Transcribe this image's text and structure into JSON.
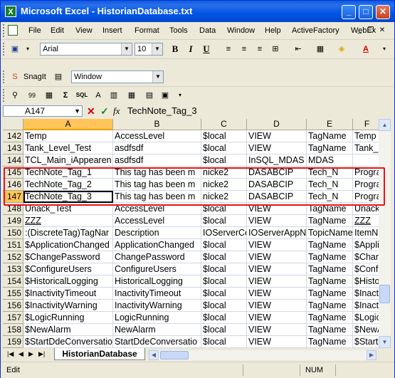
{
  "window": {
    "title": "Microsoft Excel - HistorianDatabase.txt"
  },
  "menu": [
    "File",
    "Edit",
    "View",
    "Insert",
    "Format",
    "Tools",
    "Data",
    "Window",
    "Help",
    "ActiveFactory",
    "WebEx"
  ],
  "formatting": {
    "font": "Arial",
    "size": "10",
    "bold": "B",
    "italic": "I",
    "underline": "U"
  },
  "snagit": {
    "label": "SnagIt",
    "capture_mode": "Window"
  },
  "formula_bar": {
    "cell_ref": "A147",
    "fx": "fx",
    "content": "TechNote_Tag_3"
  },
  "grid": {
    "columns": [
      "A",
      "B",
      "C",
      "D",
      "E",
      "F"
    ],
    "selected_column": "A",
    "selected_row": "147",
    "rows": [
      {
        "n": "142",
        "cells": [
          "Temp",
          "AccessLevel",
          "$local",
          "VIEW",
          "TagName",
          "Temp"
        ]
      },
      {
        "n": "143",
        "cells": [
          "Tank_Level_Test",
          "asdfsdf",
          "$local",
          "VIEW",
          "TagName",
          "Tank_L"
        ]
      },
      {
        "n": "144",
        "cells": [
          "TCL_Main_iAppearen",
          "asdfsdf",
          "$local",
          "InSQL_MDAS",
          "MDAS",
          ""
        ]
      },
      {
        "n": "145",
        "cells": [
          "TechNote_Tag_1",
          "This tag has been m",
          "nicke2",
          "DASABCIP",
          "Tech_N",
          "Progra"
        ]
      },
      {
        "n": "146",
        "cells": [
          "TechNote_Tag_2",
          "This tag has been m",
          "nicke2",
          "DASABCIP",
          "Tech_N",
          "Progra"
        ]
      },
      {
        "n": "147",
        "cells": [
          "TechNote_Tag_3",
          "This tag has been m",
          "nicke2",
          "DASABCIP",
          "Tech_N",
          "Progra"
        ]
      },
      {
        "n": "148",
        "cells": [
          "Unack_Test",
          "AccessLevel",
          "$local",
          "VIEW",
          "TagName",
          "Unack_"
        ]
      },
      {
        "n": "149",
        "cells": [
          "ZZZ",
          "AccessLevel",
          "$local",
          "VIEW",
          "TagName",
          "ZZZ"
        ]
      },
      {
        "n": "150",
        "cells": [
          ":(DiscreteTag)TagNar",
          "Description",
          "IOServerCo",
          "IOServerAppNa",
          "TopicName",
          "ItemNa"
        ]
      },
      {
        "n": "151",
        "cells": [
          "$ApplicationChanged",
          "ApplicationChanged",
          "$local",
          "VIEW",
          "TagName",
          "$Applic"
        ]
      },
      {
        "n": "152",
        "cells": [
          "$ChangePassword",
          "ChangePassword",
          "$local",
          "VIEW",
          "TagName",
          "$Chang"
        ]
      },
      {
        "n": "153",
        "cells": [
          "$ConfigureUsers",
          "ConfigureUsers",
          "$local",
          "VIEW",
          "TagName",
          "$Config"
        ]
      },
      {
        "n": "154",
        "cells": [
          "$HistoricalLogging",
          "HistoricalLogging",
          "$local",
          "VIEW",
          "TagName",
          "$Histo"
        ]
      },
      {
        "n": "155",
        "cells": [
          "$InactivityTimeout",
          "InactivityTimeout",
          "$local",
          "VIEW",
          "TagName",
          "$Inacti"
        ]
      },
      {
        "n": "156",
        "cells": [
          "$InactivityWarning",
          "InactivityWarning",
          "$local",
          "VIEW",
          "TagName",
          "$Inacti"
        ]
      },
      {
        "n": "157",
        "cells": [
          "$LogicRunning",
          "LogicRunning",
          "$local",
          "VIEW",
          "TagName",
          "$Logic"
        ]
      },
      {
        "n": "158",
        "cells": [
          "$NewAlarm",
          "NewAlarm",
          "$local",
          "VIEW",
          "TagName",
          "$NewA"
        ]
      },
      {
        "n": "159",
        "cells": [
          "$StartDdeConversatio",
          "StartDdeConversatio",
          "$local",
          "VIEW",
          "TagName",
          "$StartI"
        ]
      }
    ]
  },
  "sheet_tab": "HistorianDatabase",
  "status": {
    "mode": "Edit",
    "num": "NUM"
  },
  "colors": {
    "title_bar": "#0055e5",
    "selection": "#ffc55a",
    "highlight_box": "#e4141b"
  }
}
